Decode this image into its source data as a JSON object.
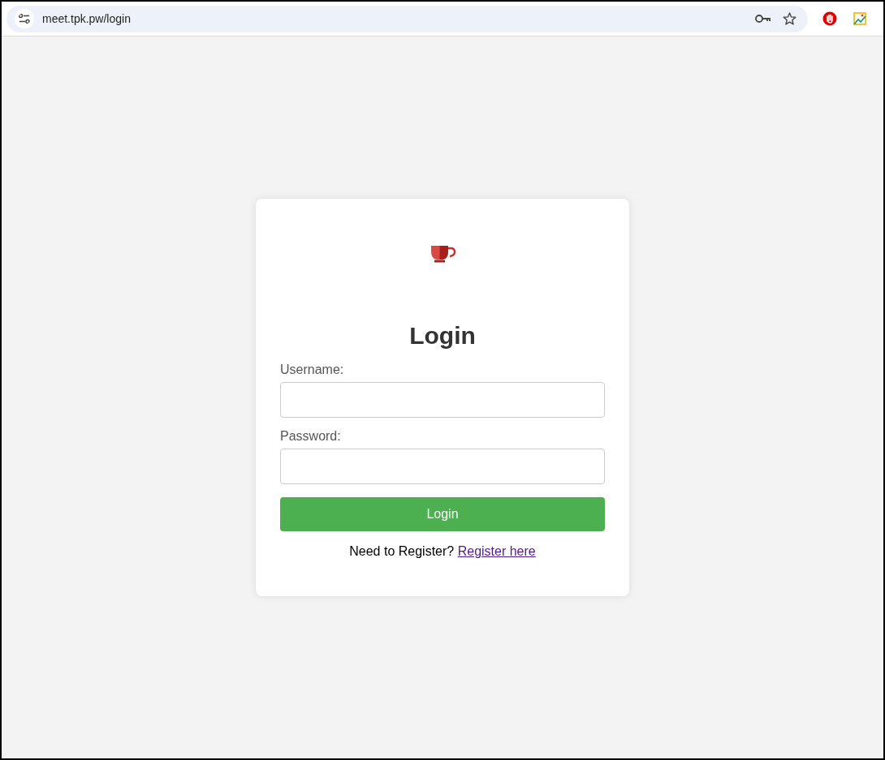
{
  "browser": {
    "url": "meet.tpk.pw/login"
  },
  "login_card": {
    "title": "Login",
    "fields": [
      {
        "label": "Username:"
      },
      {
        "label": "Password:"
      }
    ],
    "submit_button": "Login",
    "register_prompt": {
      "text": "Need to Register?",
      "link": "Register here"
    }
  }
}
